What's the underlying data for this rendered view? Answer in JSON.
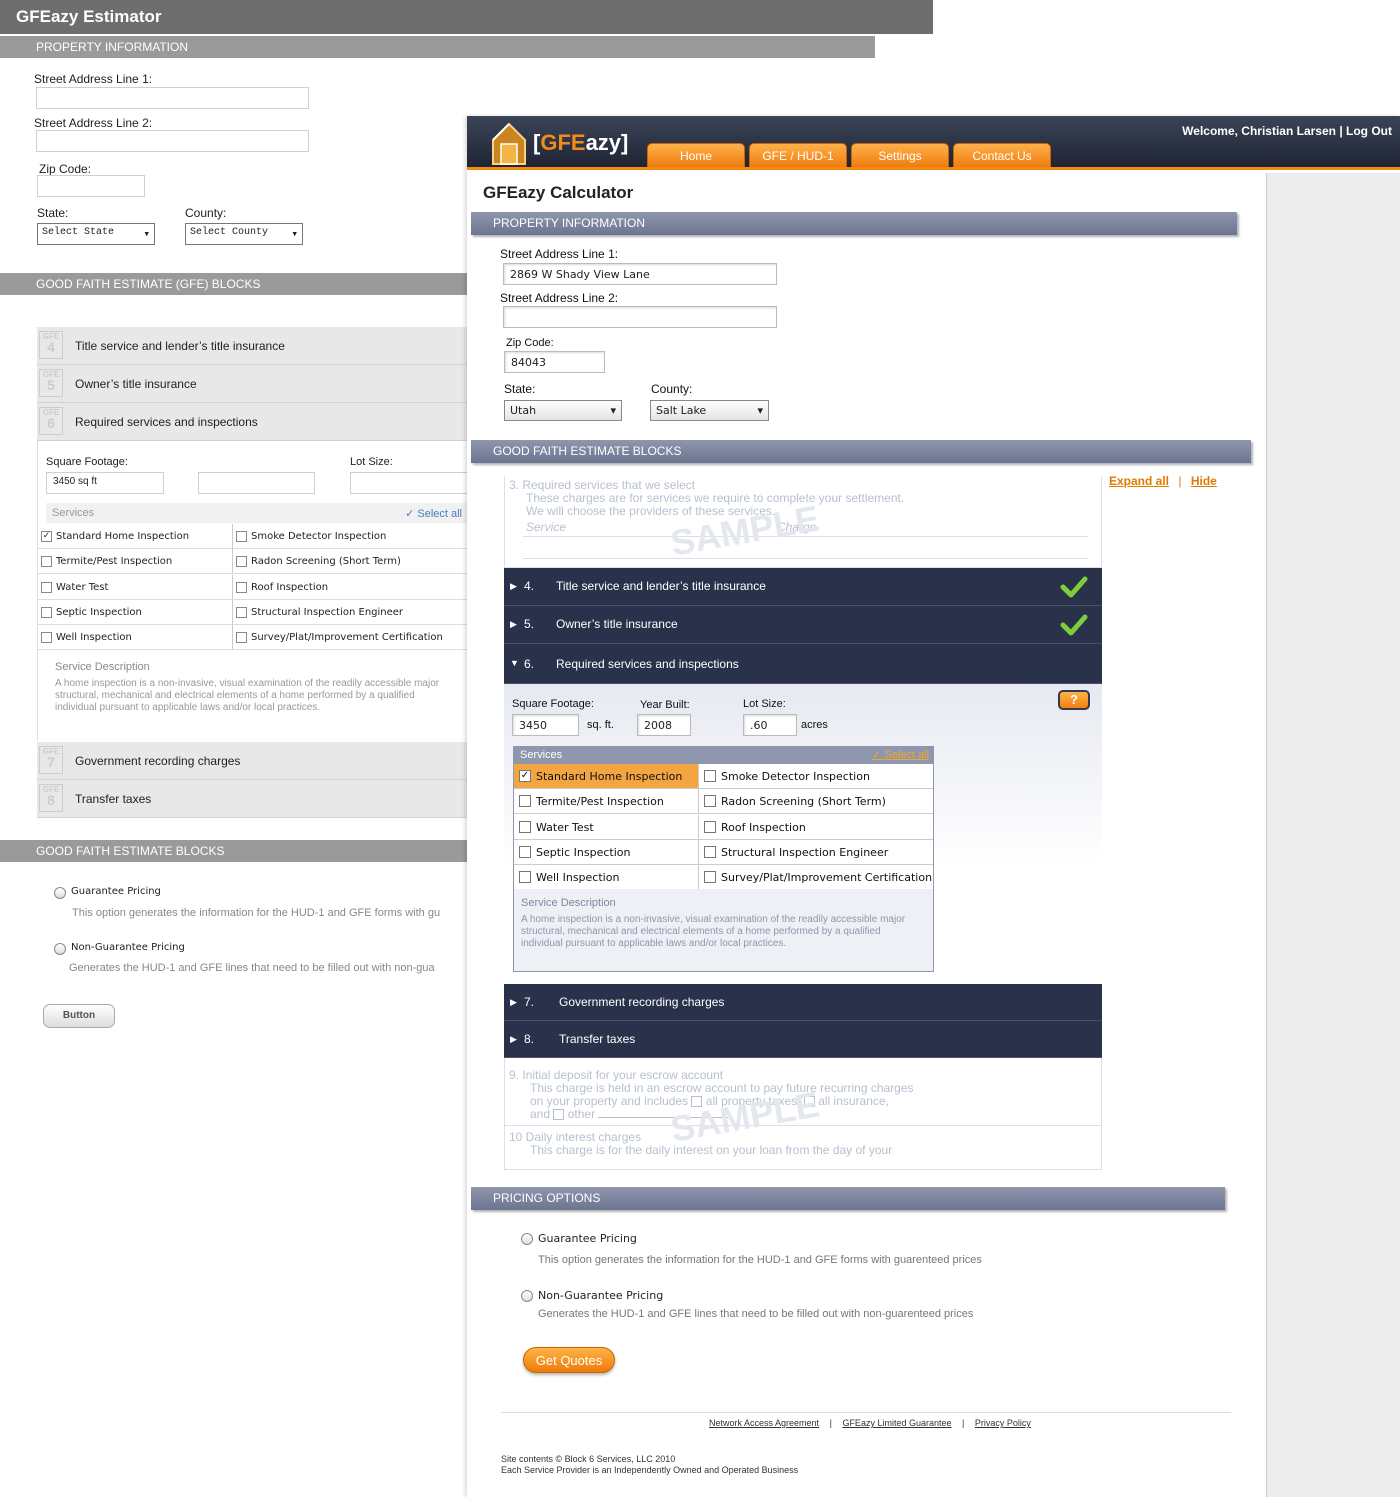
{
  "back": {
    "title": "GFEazy Estimator",
    "sections": {
      "property": "PROPERTY INFORMATION",
      "gfe_blocks": "GOOD FAITH ESTIMATE (GFE) BLOCKS",
      "gfe_blocks2": "GOOD FAITH ESTIMATE BLOCKS"
    },
    "labels": {
      "street1": "Street Address Line 1:",
      "street2": "Street Address Line 2:",
      "zip": "Zip Code:",
      "state": "State:",
      "county": "County:",
      "sqft": "Square Footage:",
      "lot": "Lot Size:"
    },
    "state_select": "Select State",
    "county_select": "Select County",
    "sqft_value": "3450 sq ft",
    "blocks": [
      {
        "badge": "GFE",
        "num": "4",
        "text": "Title service and lender’s title insurance"
      },
      {
        "badge": "GFE",
        "num": "5",
        "text": "Owner’s title insurance"
      },
      {
        "badge": "GFE",
        "num": "6",
        "text": "Required services and inspections"
      },
      {
        "badge": "GFE",
        "num": "7",
        "text": "Government recording charges"
      },
      {
        "badge": "GFE",
        "num": "8",
        "text": "Transfer taxes"
      }
    ],
    "services_header": "Services",
    "select_all": "Select all",
    "services_left": [
      "Standard Home Inspection",
      "Termite/Pest Inspection",
      "Water Test",
      "Septic Inspection",
      "Well Inspection"
    ],
    "services_right": [
      "Smoke Detector Inspection",
      "Radon Screening (Short Term)",
      "Roof Inspection",
      "Structural Inspection Engineer",
      "Survey/Plat/Improvement Certification"
    ],
    "service_desc_title": "Service Description",
    "service_desc": "A home inspection is a non-invasive, visual examination of the readily accessible major structural, mechanical and electrical elements of a home performed by a qualified individual pursuant to applicable laws and/or local practices.",
    "pricing": [
      {
        "label": "Guarantee Pricing",
        "desc": "This option generates the information for the HUD-1 and GFE forms with gu"
      },
      {
        "label": "Non-Guarantee Pricing",
        "desc": "Generates the HUD-1 and GFE lines that need to be filled out with non-gua"
      }
    ],
    "button": "Button"
  },
  "front": {
    "logo": {
      "bracket_open": "[",
      "gfe": "GFE",
      "azy": "azy",
      "bracket_close": "]"
    },
    "tabs": [
      "Home",
      "GFE / HUD-1",
      "Settings",
      "Contact Us"
    ],
    "welcome": "Welcome, Christian  Larsen |  Log Out",
    "title": "GFEazy Calculator",
    "sections": {
      "property": "PROPERTY INFORMATION",
      "gfe": "GOOD FAITH ESTIMATE BLOCKS",
      "pricing": "PRICING OPTIONS"
    },
    "labels": {
      "street1": "Street Address Line 1:",
      "street2": "Street Address Line 2:",
      "zip": "Zip Code:",
      "state": "State:",
      "county": "County:"
    },
    "values": {
      "street1": "2869 W Shady View Lane",
      "street2": "",
      "zip": "84043",
      "state": "Utah",
      "county": "Salt Lake"
    },
    "expand_all": "Expand all",
    "hide": "Hide",
    "sample_block3": {
      "title": "3.  Required services that we select",
      "line1": "These charges are for services we require to complete your settlement.",
      "line2": "We will choose the providers of these services.",
      "col1": "Service",
      "col2": "Charge",
      "watermark": "SAMPLE"
    },
    "rows": [
      {
        "num": "4.",
        "text": "Title service and lender’s title insurance",
        "checked": true
      },
      {
        "num": "5.",
        "text": "Owner’s title insurance",
        "checked": true
      },
      {
        "num": "6.",
        "text": "Required services and inspections",
        "checked": false
      },
      {
        "num": "7.",
        "text": "Government recording charges",
        "checked": false
      },
      {
        "num": "8.",
        "text": "Transfer taxes",
        "checked": false
      }
    ],
    "inspection": {
      "sqft_label": "Square Footage:",
      "sqft_value": "3450",
      "sqft_unit": "sq. ft.",
      "year_label": "Year Built:",
      "year_value": "2008",
      "lot_label": "Lot Size:",
      "lot_value": ".60",
      "lot_unit": "acres",
      "help": "?"
    },
    "services_header": "Services",
    "select_all": "Select all",
    "services_left": [
      "Standard Home Inspection",
      "Termite/Pest Inspection",
      "Water Test",
      "Septic Inspection",
      "Well Inspection"
    ],
    "services_right": [
      "Smoke Detector Inspection",
      "Radon Screening (Short Term)",
      "Roof Inspection",
      "Structural Inspection Engineer",
      "Survey/Plat/Improvement Certification"
    ],
    "service_desc_title": "Service Description",
    "service_desc": "A home inspection is a non-invasive, visual examination of the readily accessible major structural, mechanical and electrical elements of a home performed by a qualified individual pursuant to applicable laws and/or local practices.",
    "sample_block9": {
      "title": "9.  Initial deposit for your escrow account",
      "line1": "This charge is held in an escrow account to pay future recurring charges",
      "line2a": "on your property and includes",
      "line2b": "all property taxes,",
      "line2c": "all insurance,",
      "line3a": "and",
      "line3b": "other",
      "watermark": "SAMPLE"
    },
    "sample_block10": {
      "title": "10  Daily interest charges",
      "line1": "This charge is for the daily interest on your loan from the day of your"
    },
    "pricing": [
      {
        "label": "Guarantee Pricing",
        "desc": "This option generates the information for the HUD-1 and GFE forms with guarenteed prices"
      },
      {
        "label": "Non-Guarantee Pricing",
        "desc": "Generates the HUD-1 and GFE lines that need to be filled out with non-guarenteed prices"
      }
    ],
    "get_quotes": "Get Quotes",
    "footer_links": [
      "Network Access Agreement",
      "GFEazy Limited Guarantee",
      "Privacy Policy"
    ],
    "footer_sep": "|",
    "copyright1": "Site contents © Block 6 Services, LLC 2010",
    "copyright2": "Each Service Provider is an Independently Owned and Operated Business"
  },
  "colors": {
    "accent": "#f08a10",
    "nav_dark": "#29324a",
    "section_blue": "#7d86a0"
  }
}
